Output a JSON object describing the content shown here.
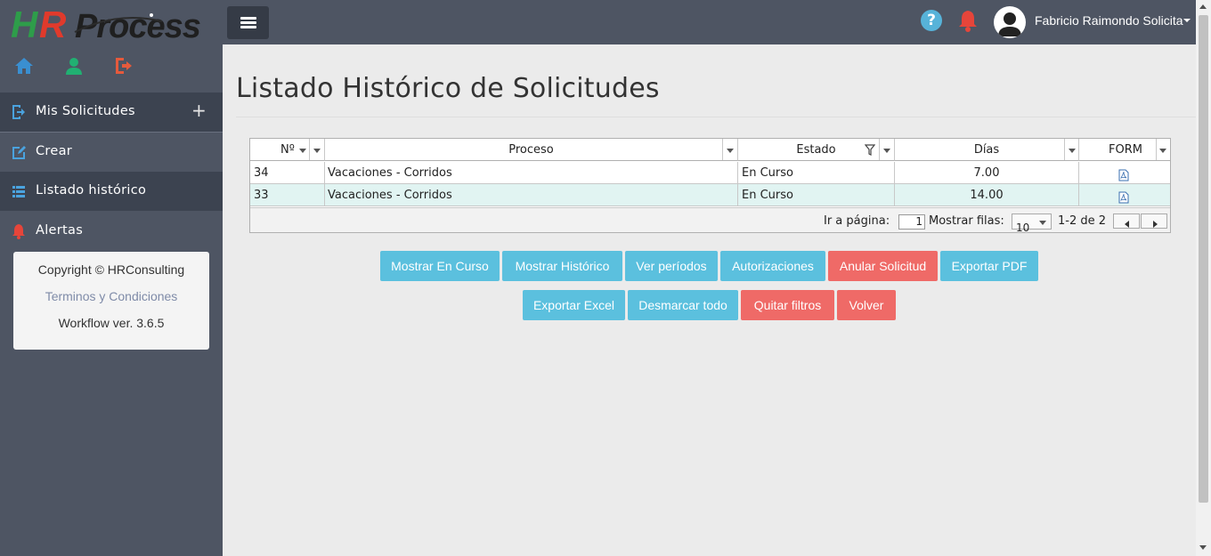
{
  "app": {
    "logo_text": "HRProcess",
    "user_name": "Fabricio Raimondo Solicita"
  },
  "sidebar": {
    "items": [
      {
        "label": "Mis Solicitudes",
        "icon": "sign-in-icon",
        "expand": "+"
      },
      {
        "label": "Crear",
        "icon": "edit-icon"
      },
      {
        "label": "Listado histórico",
        "icon": "list-icon"
      },
      {
        "label": "Alertas",
        "icon": "bell-icon"
      }
    ],
    "footer": {
      "copyright": "Copyright © HRConsulting",
      "terms": "Terminos y Condiciones",
      "version": "Workflow ver. 3.6.5"
    }
  },
  "main": {
    "title": "Listado Histórico de Solicitudes"
  },
  "grid": {
    "columns": [
      "Nº",
      "Proceso",
      "Estado",
      "Días",
      "FORM"
    ],
    "rows": [
      {
        "num": "34",
        "proceso": "Vacaciones - Corridos",
        "estado": "En Curso",
        "dias": "7.00",
        "form": "pdf-icon"
      },
      {
        "num": "33",
        "proceso": "Vacaciones - Corridos",
        "estado": "En Curso",
        "dias": "14.00",
        "form": "pdf-icon"
      }
    ],
    "pager": {
      "goto_label": "Ir a página:",
      "page_value": "1",
      "rows_label": "Mostrar filas:",
      "rows_value": "10",
      "range": "1-2 de 2"
    }
  },
  "actions": {
    "row1": [
      "Mostrar En Curso",
      "Mostrar Histórico",
      "Ver períodos",
      "Autorizaciones",
      "Anular Solicitud",
      "Exportar PDF"
    ],
    "row2": [
      "Exportar Excel",
      "Desmarcar todo",
      "Quitar filtros",
      "Volver"
    ]
  },
  "colors": {
    "sidebar_bg": "#4e5563",
    "sidebar_active": "#3c4350",
    "btn_info": "#5bc0de",
    "btn_danger": "#ef6a67",
    "row_alt": "#e1f4f2"
  }
}
